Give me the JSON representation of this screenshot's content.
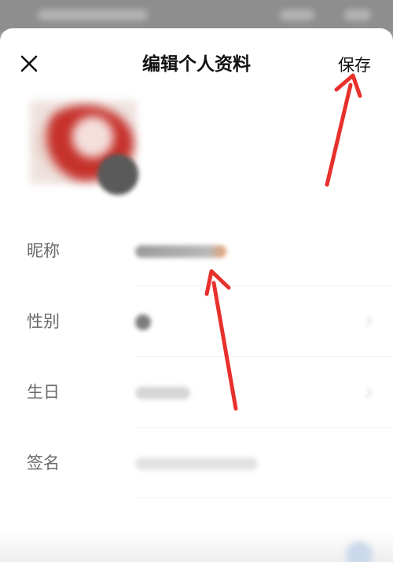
{
  "window": {
    "title": "编辑个人资料"
  },
  "header": {
    "close_icon": "close-icon",
    "title": "编辑个人资料",
    "save_label": "保存"
  },
  "profile": {
    "avatar_icon": "avatar",
    "camera_badge_icon": "camera-icon",
    "fields": [
      {
        "label": "昵称"
      },
      {
        "label": "性别"
      },
      {
        "label": "生日"
      },
      {
        "label": "签名"
      }
    ]
  },
  "colors": {
    "annotation_arrow": "#e8302c",
    "label_text": "#6a6a6a",
    "title_text": "#111111"
  }
}
